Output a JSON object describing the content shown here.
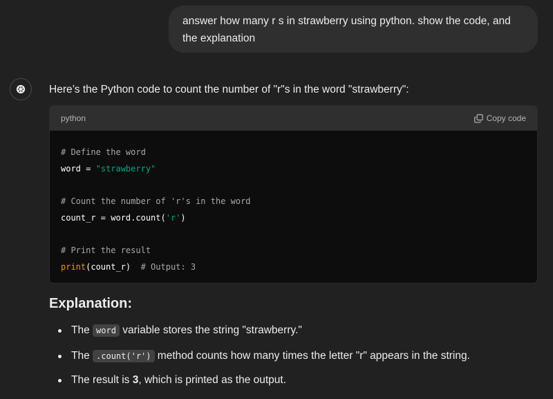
{
  "user_message": {
    "text": "answer how many r s in strawberry using python. show the code, and the explanation"
  },
  "assistant": {
    "avatar_icon": "openai-logo-icon",
    "intro": "Here’s the Python code to count the number of \"r\"s in the word \"strawberry\":",
    "code_block": {
      "language": "python",
      "copy_label": "Copy code",
      "copy_icon": "copy-icon",
      "lines": {
        "l1_comment": "# Define the word",
        "l2_var": "word = ",
        "l2_str": "\"strawberry\"",
        "l3_comment": "# Count the number of 'r's in the word",
        "l4_pre": "count_r = word.count(",
        "l4_str": "'r'",
        "l4_post": ")",
        "l5_comment": "# Print the result",
        "l6_fn": "print",
        "l6_args": "(count_r)",
        "l6_comment": "  # Output: 3"
      }
    },
    "explanation": {
      "heading": "Explanation:",
      "bullets": [
        {
          "pre": "The ",
          "code": "word",
          "post": " variable stores the string \"strawberry.\""
        },
        {
          "pre": "The ",
          "code": ".count('r')",
          "post": " method counts how many times the letter \"r\" appears in the string."
        },
        {
          "pre": "The result is ",
          "bold": "3",
          "post": ", which is printed as the output."
        }
      ]
    }
  },
  "colors": {
    "background": "#212121",
    "user_bubble": "#2f2f2f",
    "code_bg": "#0d0d0d",
    "code_header": "#2f2f2f",
    "string_green": "#00a67d",
    "builtin_orange": "#e9950c",
    "comment_gray": "#a8a8a8"
  }
}
